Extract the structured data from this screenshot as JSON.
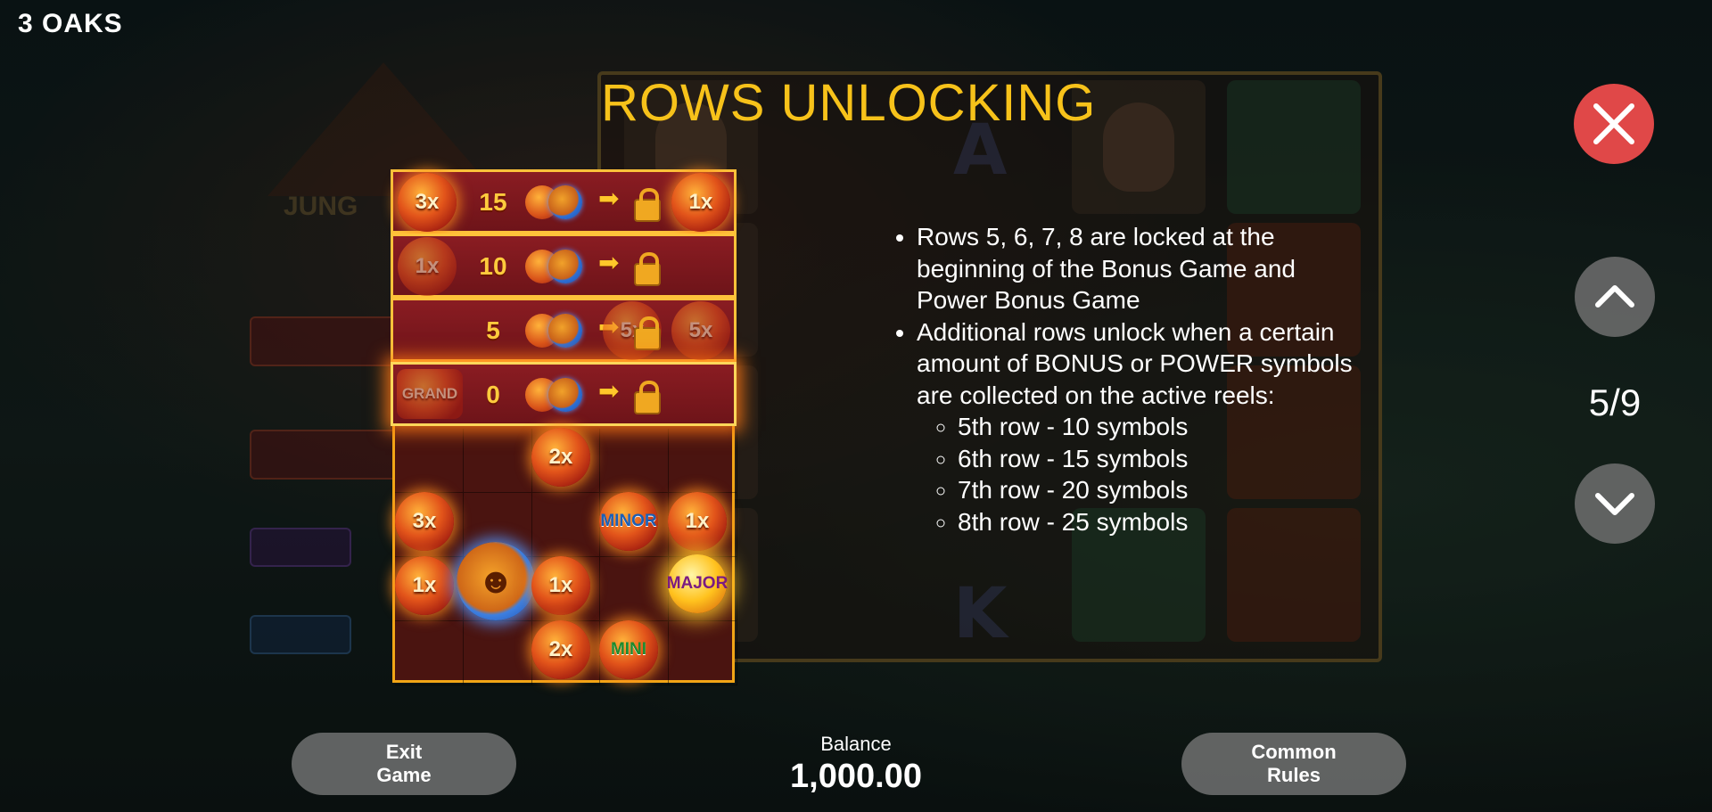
{
  "app": {
    "brand": "3 OAKS"
  },
  "page": {
    "title": "ROWS UNLOCKING",
    "page_indicator": "5/9"
  },
  "illustration": {
    "rows": [
      {
        "left_symbol": "3x",
        "count": "15",
        "right_symbol": "1x"
      },
      {
        "left_symbol": "1x",
        "count": "10",
        "right_symbol": ""
      },
      {
        "left_symbol": "",
        "count": "5",
        "right_symbol": "5x",
        "lock_symbol": "5x"
      },
      {
        "left_symbol": "GRAND",
        "count": "0",
        "right_symbol": ""
      }
    ],
    "open_symbols": {
      "a": "2x",
      "b": "3x",
      "c": "MINOR",
      "d": "1x",
      "e": "1x",
      "f": "1x",
      "g": "MAJOR",
      "h": "2x",
      "i": "MINI"
    }
  },
  "rules": {
    "bullet_1": "Rows 5, 6, 7, 8 are locked at the beginning of the Bonus Game and Power Bonus Game",
    "bullet_2": "Additional rows unlock when a certain amount of BONUS or POWER symbols are collected on the active reels:",
    "sub_items": [
      "5th row - 10 symbols",
      "6th row - 15 symbols",
      "7th row - 20 symbols",
      "8th row - 25 symbols"
    ]
  },
  "controls": {
    "close_icon": "close-icon",
    "prev_icon": "chevron-up-icon",
    "next_icon": "chevron-down-icon"
  },
  "footer": {
    "exit_label": "Exit\nGame",
    "balance_label": "Balance",
    "balance_value": "1,000.00",
    "common_rules_label": "Common\nRules"
  },
  "colors": {
    "title": "#f7c21a",
    "close_button": "#e04848",
    "nav_button": "#6e6e6e",
    "frame": "#f2a516"
  }
}
